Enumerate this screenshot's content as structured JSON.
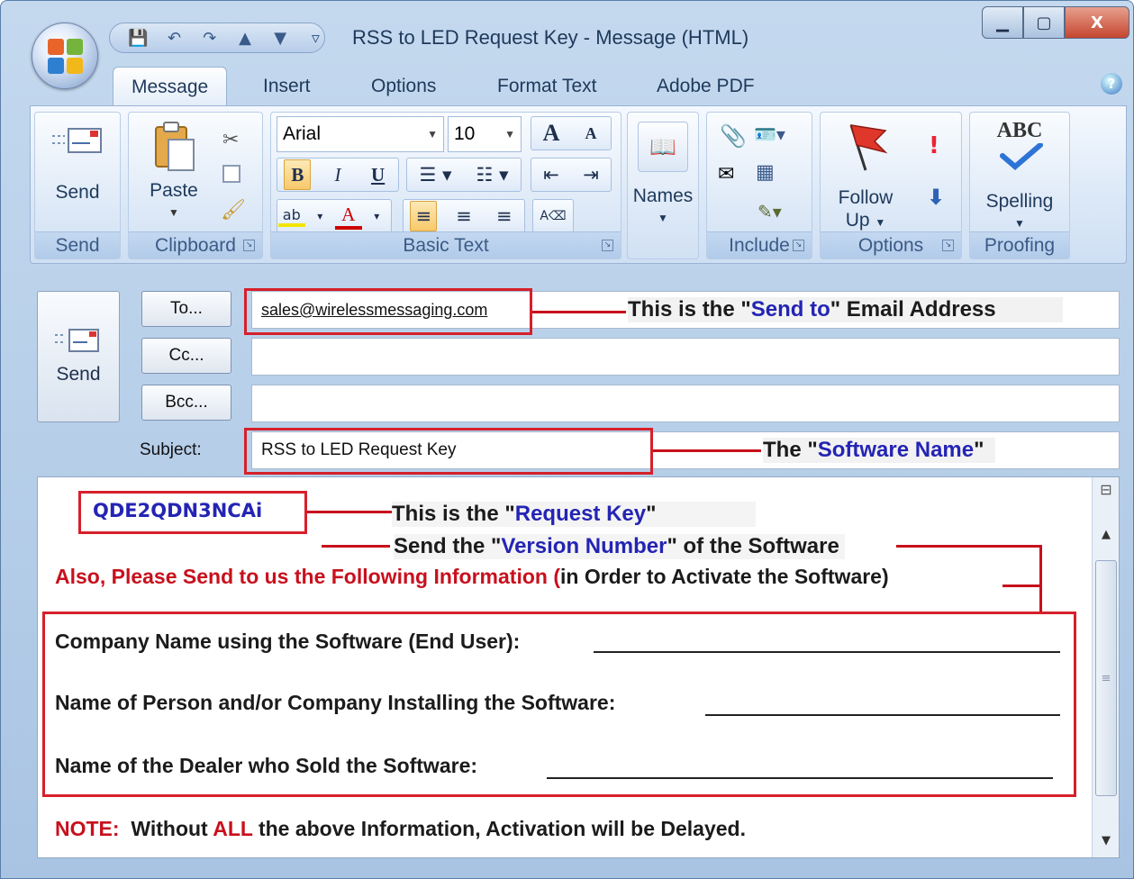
{
  "window": {
    "title": "RSS to LED Request Key - Message (HTML)",
    "minimize_glyph": "▁",
    "maximize_glyph": "▢",
    "close_glyph": "X"
  },
  "quick_access": {
    "save_icon": "💾",
    "undo_icon": "↶",
    "redo_icon": "↷",
    "up_icon": "▲",
    "down_icon": "▼",
    "more_icon": "▿"
  },
  "tabs": [
    "Message",
    "Insert",
    "Options",
    "Format Text",
    "Adobe PDF"
  ],
  "ribbon": {
    "send": {
      "button": "Send",
      "label": "Send"
    },
    "clipboard": {
      "paste": "Paste",
      "label": "Clipboard"
    },
    "basic_text": {
      "font": "Arial",
      "size": "10",
      "label": "Basic Text",
      "bold": "B",
      "italic": "I",
      "underline": "U",
      "grow": "A",
      "shrink": "A",
      "color": "A"
    },
    "names": {
      "button": "Names"
    },
    "include": {
      "label": "Include"
    },
    "options": {
      "follow_up_1": "Follow",
      "follow_up_2": "Up",
      "label": "Options"
    },
    "proofing": {
      "abc": "ABC",
      "spelling": "Spelling",
      "label": "Proofing"
    }
  },
  "compose": {
    "send_button": "Send",
    "to_button": "To...",
    "cc_button": "Cc...",
    "bcc_button": "Bcc...",
    "to_value": "sales@wirelessmessaging.com",
    "cc_value": "",
    "bcc_value": "",
    "subject_label": "Subject:",
    "subject_value": "RSS to LED Request Key"
  },
  "annotations": {
    "send_to_pre": "This is the \"",
    "send_to_hl": "Send to",
    "send_to_post": "\" Email Address",
    "software_pre": "The \"",
    "software_hl": "Software Name",
    "software_post": "\"",
    "request_pre": "This is the \"",
    "request_hl": "Request Key",
    "request_post": "\"",
    "version_pre": "Send the \"",
    "version_hl": "Version Number",
    "version_post": "\" of the Software"
  },
  "message_body": {
    "request_key": "QDE2QDN3NCAi",
    "also_red": "Also, Please Send to us the Following Information (",
    "also_black": "in Order to Activate the Software)",
    "line1": "Company Name using the Software (End User):",
    "line2": "Name of Person and/or Company Installing the Software:",
    "line3": "Name of the Dealer who Sold the Software:",
    "note_label": "NOTE:",
    "note_a": "Without",
    "note_all": "ALL",
    "note_b": "the above Information, Activation will be Delayed."
  }
}
